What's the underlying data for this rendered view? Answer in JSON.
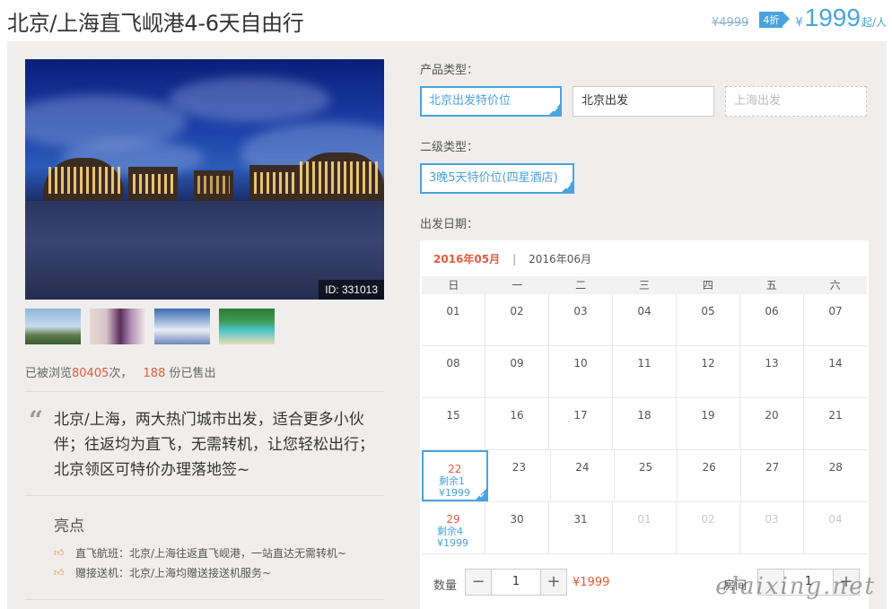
{
  "header": {
    "title": "北京/上海直飞岘港4-6天自由行",
    "old_price": "¥4999",
    "discount": "4折",
    "currency": "¥",
    "price": "1999",
    "price_unit": "起/人"
  },
  "gallery": {
    "photo_id": "ID: 331013",
    "thumbnails": [
      "resort-street",
      "bedroom",
      "sky-clouds",
      "beach-island"
    ]
  },
  "stats": {
    "viewed_prefix": "已被浏览",
    "viewed_count": "80405",
    "viewed_suffix": "次，",
    "sold_count": "188",
    "sold_suffix": "份已售出"
  },
  "quote": {
    "text": "北京/上海，两大热门城市出发，适合更多小伙伴；往返均为直飞，无需转机，让您轻松出行；北京领区可特价办理落地签~"
  },
  "highlights": {
    "title": "亮点",
    "items": [
      "直飞航班：北京/上海往返直飞岘港，一站直达无需转机~",
      "赠接送机：北京/上海均赠送接送机服务~"
    ]
  },
  "product_type": {
    "label": "产品类型：",
    "options": [
      "北京出发特价位",
      "北京出发",
      "上海出发"
    ]
  },
  "sub_type": {
    "label": "二级类型：",
    "options": [
      "3晚5天特价位(四星酒店)"
    ]
  },
  "departure": {
    "label": "出发日期：",
    "month_current": "2016年05月",
    "month_separator": "|",
    "month_next": "2016年06月",
    "weekdays": [
      "日",
      "一",
      "二",
      "三",
      "四",
      "五",
      "六"
    ],
    "weeks": [
      [
        "01",
        "02",
        "03",
        "04",
        "05",
        "06",
        "07"
      ],
      [
        "08",
        "09",
        "10",
        "11",
        "12",
        "13",
        "14"
      ],
      [
        "15",
        "16",
        "17",
        "18",
        "19",
        "20",
        "21"
      ],
      [
        "22",
        "23",
        "24",
        "25",
        "26",
        "27",
        "28"
      ],
      [
        "29",
        "30",
        "31",
        "01",
        "02",
        "03",
        "04"
      ]
    ],
    "avail_22": {
      "remaining": "剩余1",
      "price": "¥1999"
    },
    "avail_29": {
      "remaining": "剩余4",
      "price": "¥1999"
    }
  },
  "quantity": {
    "label": "数量",
    "minus": "−",
    "value": "1",
    "plus": "+",
    "price": "¥1999",
    "room_label": "房间",
    "room_value": "1"
  },
  "watermark": "elaixing.net"
}
